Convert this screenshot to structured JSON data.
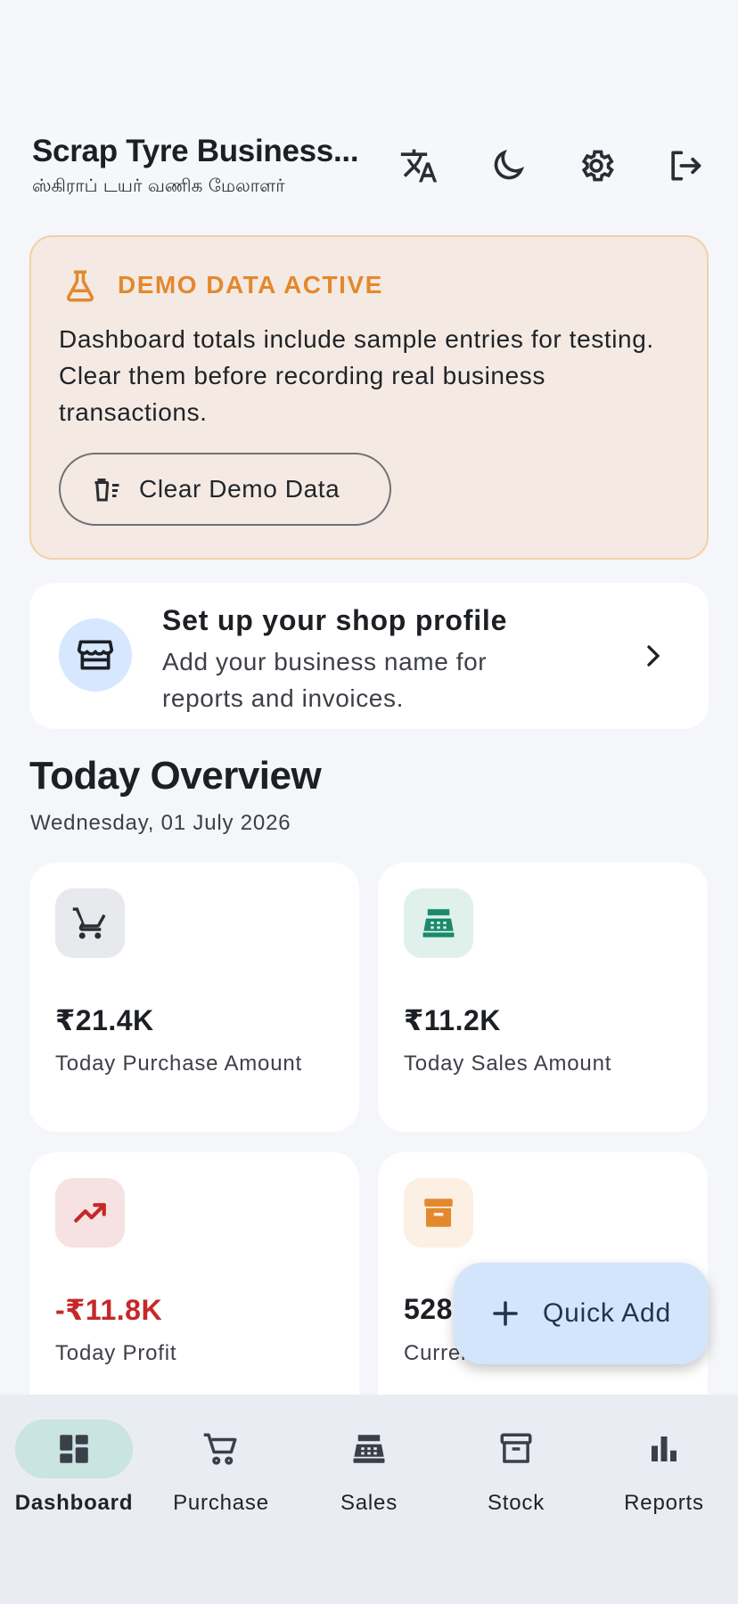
{
  "header": {
    "title": "Scrap Tyre Business...",
    "subtitle": "ஸ்கிராப் டயர் வணிக மேலாளர்",
    "icons": [
      "translate-icon",
      "dark-mode-icon",
      "settings-icon",
      "logout-icon"
    ]
  },
  "demo_banner": {
    "title": "DEMO DATA ACTIVE",
    "text": "Dashboard totals include sample entries for testing. Clear them before recording real business transactions.",
    "button_label": "Clear Demo Data",
    "accent_color": "#e3882d"
  },
  "profile_card": {
    "title": "Set up your shop profile",
    "subtitle": "Add your business name for reports and invoices."
  },
  "overview": {
    "title": "Today Overview",
    "date": "Wednesday, 01 July 2026",
    "cards": [
      {
        "value": "₹21.4K",
        "label": "Today Purchase Amount",
        "icon": "cart-icon",
        "icon_color": "#2a2e35",
        "icon_bg": "#e8e9ec"
      },
      {
        "value": "₹11.2K",
        "label": "Today Sales Amount",
        "icon": "cash-register-icon",
        "icon_color": "#1a8a6b",
        "icon_bg": "#e0f1ec"
      },
      {
        "value": "-₹11.8K",
        "label": "Today Profit",
        "icon": "trending-up-icon",
        "icon_color": "#c62828",
        "icon_bg": "#f6e2e2",
        "value_color": "#c62828"
      },
      {
        "value": "528",
        "label": "Current Stock",
        "icon": "inventory-box-icon",
        "icon_color": "#e3882d",
        "icon_bg": "#fcefe3"
      }
    ]
  },
  "fab": {
    "label": "Quick Add"
  },
  "bottom_nav": {
    "items": [
      {
        "label": "Dashboard",
        "icon": "dashboard-icon",
        "active": true
      },
      {
        "label": "Purchase",
        "icon": "cart-icon",
        "active": false
      },
      {
        "label": "Sales",
        "icon": "cash-register-icon",
        "active": false
      },
      {
        "label": "Stock",
        "icon": "inventory-box-icon",
        "active": false
      },
      {
        "label": "Reports",
        "icon": "bar-chart-icon",
        "active": false
      }
    ]
  }
}
